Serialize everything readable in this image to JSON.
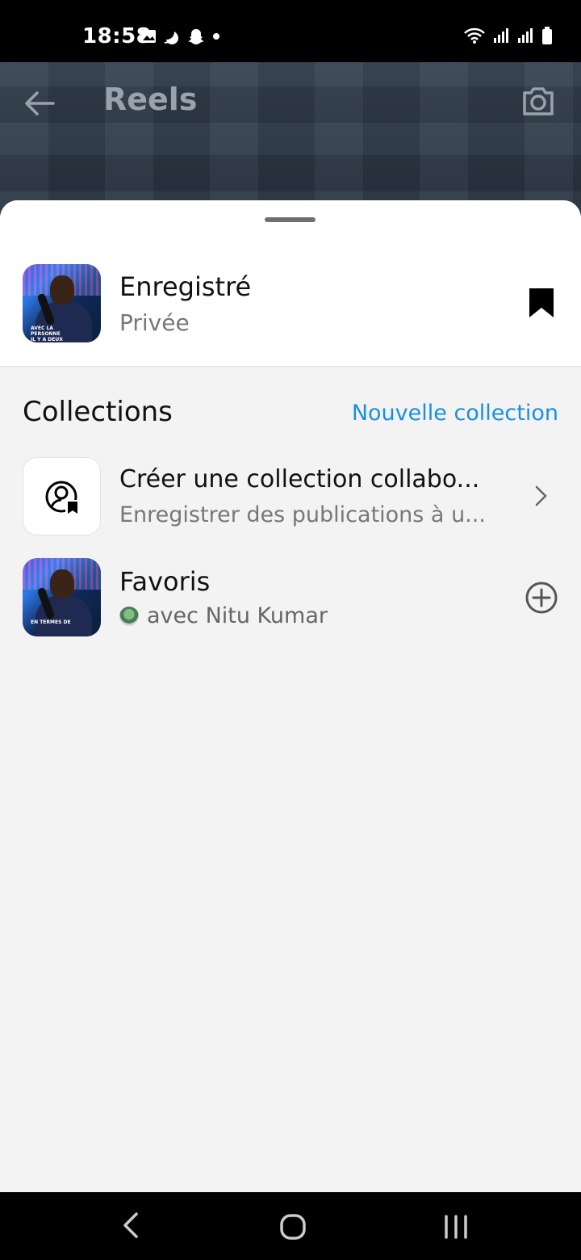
{
  "status_bar": {
    "time": "18:58",
    "left_icons": [
      "image-icon",
      "moon-icon",
      "snapchat-icon",
      "dot-icon"
    ],
    "right_icons": [
      "wifi-icon",
      "signal-icon",
      "signal-icon",
      "battery-icon"
    ]
  },
  "background": {
    "title": "Reels",
    "back_icon": "arrow-left-icon",
    "camera_icon": "camera-icon"
  },
  "sheet": {
    "saved": {
      "name": "Enregistré",
      "privacy": "Privée",
      "thumbnail_caption_line1": "AVEC LA PERSONNE",
      "thumbnail_caption_line2": "IL Y A DEUX",
      "bookmark_icon": "bookmark-filled-icon"
    },
    "collections": {
      "title": "Collections",
      "new_label": "Nouvelle collection"
    },
    "collab": {
      "title": "Créer une collection collabo...",
      "subtitle": "Enregistrer des publications à u...",
      "icon": "collab-collection-icon"
    },
    "favorites": {
      "title": "Favoris",
      "subtitle": "avec Nitu Kumar",
      "thumbnail_caption": "EN TERMES DE",
      "add_icon": "plus-circle-icon"
    }
  },
  "nav_bar": {
    "icons": [
      "back-icon",
      "home-icon",
      "recents-icon"
    ]
  },
  "colors": {
    "accent": "#1a8fe0",
    "sheet_bg": "#f3f3f3",
    "text_secondary": "#777777"
  }
}
